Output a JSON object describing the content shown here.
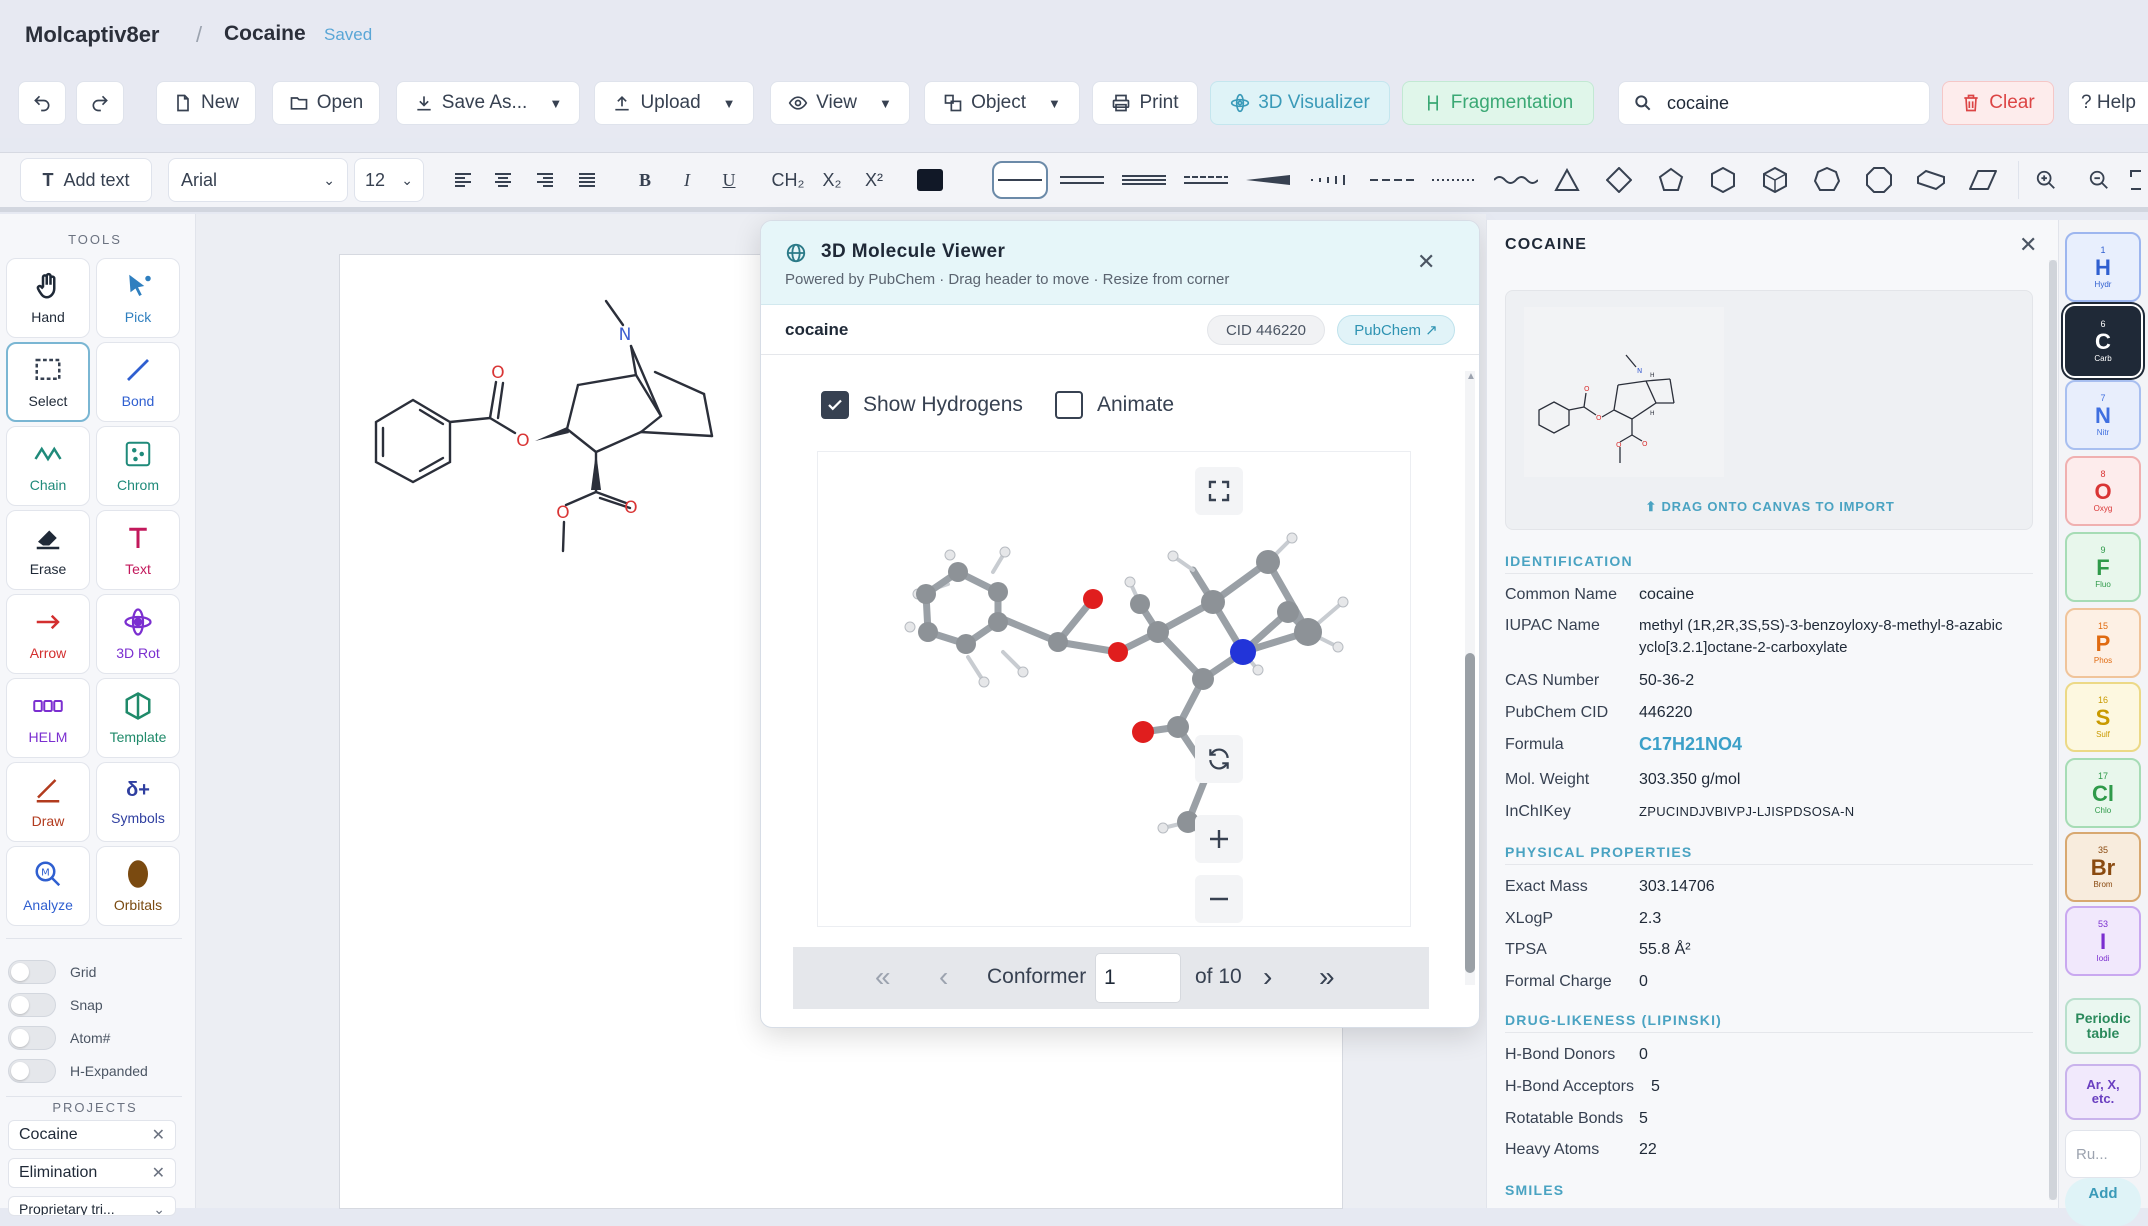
{
  "app": {
    "name": "Molcaptiv8er",
    "document": "Cocaine",
    "status": "Saved"
  },
  "toolbar": {
    "new": "New",
    "open": "Open",
    "save_as": "Save As...",
    "upload": "Upload",
    "view": "View",
    "object": "Object",
    "print": "Print",
    "visualizer": "3D Visualizer",
    "fragmentation": "Fragmentation",
    "search_value": "cocaine",
    "clear": "Clear",
    "help": "? Help"
  },
  "format": {
    "add_text": "Add text",
    "font": "Arial",
    "size": "12",
    "ch2": "CH₂",
    "sub": "X₂",
    "sup": "X²",
    "bold": "B",
    "italic": "I",
    "underline": "U"
  },
  "tools": {
    "header": "TOOLS",
    "items": [
      {
        "label": "Hand",
        "color": "#1f2937"
      },
      {
        "label": "Pick",
        "color": "#2f7fbf"
      },
      {
        "label": "Select",
        "color": "#374151"
      },
      {
        "label": "Bond",
        "color": "#2f5fd0"
      },
      {
        "label": "Chain",
        "color": "#1f8a7a"
      },
      {
        "label": "Chrom",
        "color": "#1f8a7a"
      },
      {
        "label": "Erase",
        "color": "#1f2937"
      },
      {
        "label": "Text",
        "color": "#c2185b"
      },
      {
        "label": "Arrow",
        "color": "#d32f2f"
      },
      {
        "label": "3D Rot",
        "color": "#7b2fd0"
      },
      {
        "label": "HELM",
        "color": "#7b2fd0"
      },
      {
        "label": "Template",
        "color": "#1f8a6a"
      },
      {
        "label": "Draw",
        "color": "#b23b1e"
      },
      {
        "label": "Symbols",
        "color": "#2f3fa0"
      },
      {
        "label": "Analyze",
        "color": "#2f5fd0"
      },
      {
        "label": "Orbitals",
        "color": "#7a4a10"
      }
    ],
    "toggles": [
      "Grid",
      "Snap",
      "Atom#",
      "H-Expanded"
    ],
    "projects_header": "PROJECTS",
    "projects": [
      "Cocaine",
      "Elimination",
      "Proprietary tri..."
    ]
  },
  "viewer": {
    "title": "3D Molecule Viewer",
    "subtitle": "Powered by PubChem · Drag header to move · Resize from corner",
    "compound": "cocaine",
    "cid": "CID 446220",
    "pubchem": "PubChem ↗",
    "show_hydrogens": "Show Hydrogens",
    "animate": "Animate",
    "conformer_label": "Conformer",
    "conformer_value": "1",
    "conformer_total": "of 10"
  },
  "info": {
    "title": "COCAINE",
    "drag_hint": "⬆ DRAG ONTO CANVAS TO IMPORT",
    "identification": "IDENTIFICATION",
    "ident_rows": [
      {
        "k": "Common Name",
        "v": "cocaine"
      },
      {
        "k": "IUPAC Name",
        "v": "methyl (1R,2R,3S,5S)-3-benzoyloxy-8-methyl-8-azabic",
        "v2": "yclo[3.2.1]octane-2-carboxylate"
      },
      {
        "k": "CAS Number",
        "v": "50-36-2"
      },
      {
        "k": "PubChem CID",
        "v": "446220"
      },
      {
        "k": "Formula",
        "v": "C17H21NO4"
      },
      {
        "k": "Mol. Weight",
        "v": "303.350 g/mol"
      },
      {
        "k": "InChIKey",
        "v": "ZPUCINDJVBIVPJ-LJISPDSOSA-N"
      }
    ],
    "physical": "PHYSICAL PROPERTIES",
    "phys_rows": [
      {
        "k": "Exact Mass",
        "v": "303.14706"
      },
      {
        "k": "XLogP",
        "v": "2.3"
      },
      {
        "k": "TPSA",
        "v": "55.8 Å²"
      },
      {
        "k": "Formal Charge",
        "v": "0"
      }
    ],
    "lipinski": "DRUG-LIKENESS (LIPINSKI)",
    "lip_rows": [
      {
        "k": "H-Bond Donors",
        "v": "0"
      },
      {
        "k": "H-Bond Acceptors",
        "v": "5"
      },
      {
        "k": "Rotatable Bonds",
        "v": "5"
      },
      {
        "k": "Heavy Atoms",
        "v": "22"
      }
    ],
    "smiles": "SMILES"
  },
  "elements": [
    {
      "num": "1",
      "sym": "H",
      "name": "Hydr",
      "color": "#2f5fd0",
      "bg": "#e8effd",
      "border": "#9db6ef"
    },
    {
      "num": "6",
      "sym": "C",
      "name": "Carb",
      "color": "#ffffff",
      "bg": "#1f2937",
      "border": "#1f2937"
    },
    {
      "num": "7",
      "sym": "N",
      "name": "Nitr",
      "color": "#3f6fe0",
      "bg": "#e8eefc",
      "border": "#a8bff0"
    },
    {
      "num": "8",
      "sym": "O",
      "name": "Oxyg",
      "color": "#d93535",
      "bg": "#fdecec",
      "border": "#f0b0b0"
    },
    {
      "num": "9",
      "sym": "F",
      "name": "Fluo",
      "color": "#2f9a4a",
      "bg": "#e8f7ec",
      "border": "#a6dcb5"
    },
    {
      "num": "15",
      "sym": "P",
      "name": "Phos",
      "color": "#e06a10",
      "bg": "#fdf0e4",
      "border": "#f0c49a"
    },
    {
      "num": "16",
      "sym": "S",
      "name": "Sulf",
      "color": "#c99a00",
      "bg": "#fdf8e0",
      "border": "#ecd986"
    },
    {
      "num": "17",
      "sym": "Cl",
      "name": "Chlo",
      "color": "#2f9a4a",
      "bg": "#e8f7ec",
      "border": "#a6dcb5"
    },
    {
      "num": "35",
      "sym": "Br",
      "name": "Brom",
      "color": "#8a4a10",
      "bg": "#f8ecdd",
      "border": "#d8a870"
    },
    {
      "num": "53",
      "sym": "I",
      "name": "Iodi",
      "color": "#7b2fd0",
      "bg": "#f1e8fc",
      "border": "#c9a8f0"
    }
  ],
  "element_extras": {
    "periodic": "Periodic table",
    "arx": "Ar, X, etc.",
    "placeholder": "Ru...",
    "add": "Add"
  }
}
